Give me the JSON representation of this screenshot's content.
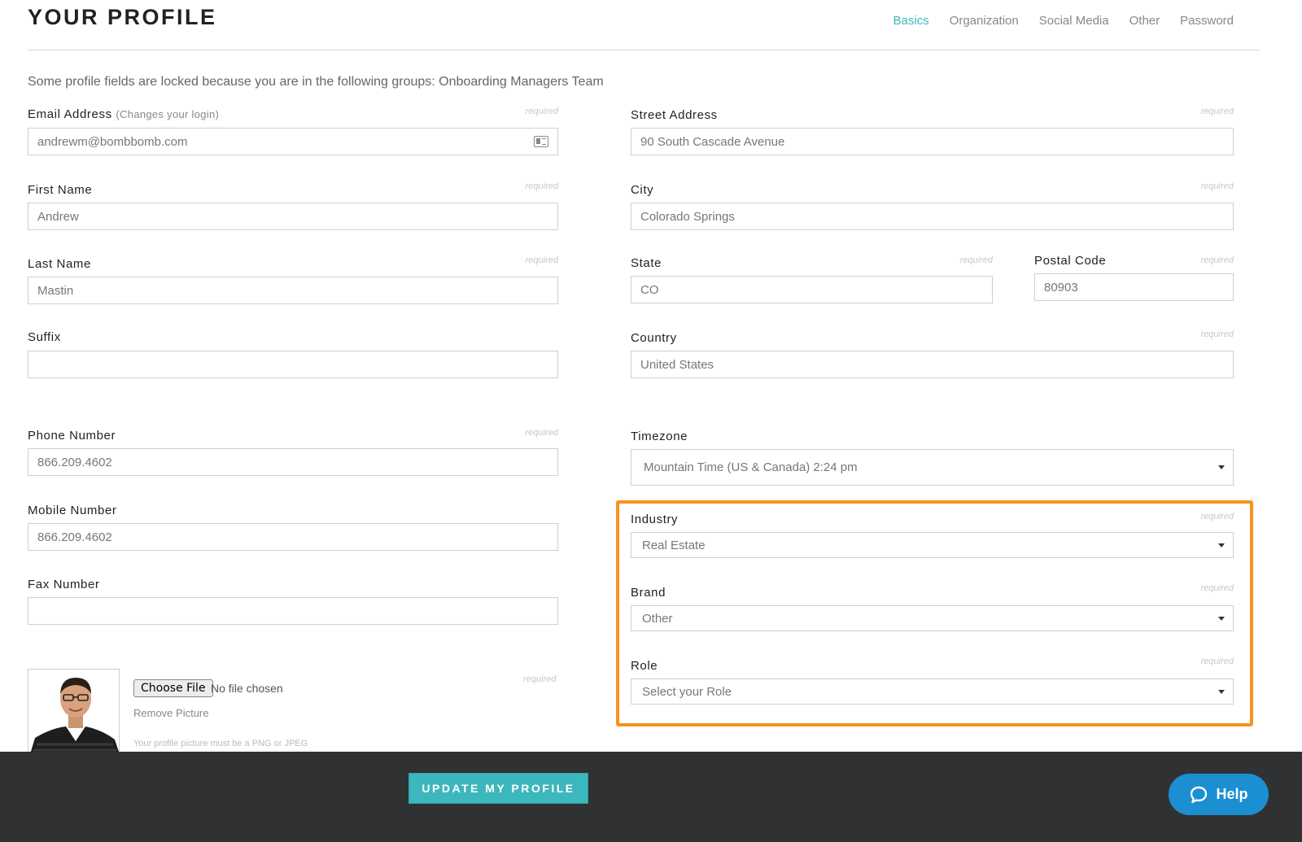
{
  "header": {
    "title": "YOUR PROFILE",
    "tabs": [
      {
        "label": "Basics",
        "active": true
      },
      {
        "label": "Organization",
        "active": false
      },
      {
        "label": "Social Media",
        "active": false
      },
      {
        "label": "Other",
        "active": false
      },
      {
        "label": "Password",
        "active": false
      }
    ]
  },
  "notice": "Some profile fields are locked because you are in the following groups: Onboarding Managers Team",
  "required_text": "required",
  "fields": {
    "email": {
      "label": "Email Address",
      "hint": "(Changes your login)",
      "value": "andrewm@bombbomb.com"
    },
    "first_name": {
      "label": "First Name",
      "value": "Andrew"
    },
    "last_name": {
      "label": "Last Name",
      "value": "Mastin"
    },
    "suffix": {
      "label": "Suffix",
      "value": ""
    },
    "phone": {
      "label": "Phone Number",
      "value": "866.209.4602"
    },
    "mobile": {
      "label": "Mobile Number",
      "value": "866.209.4602"
    },
    "fax": {
      "label": "Fax Number",
      "value": ""
    },
    "street": {
      "label": "Street Address",
      "value": "90 South Cascade Avenue"
    },
    "city": {
      "label": "City",
      "value": "Colorado Springs"
    },
    "state": {
      "label": "State",
      "value": "CO"
    },
    "postal": {
      "label": "Postal Code",
      "value": "80903"
    },
    "country": {
      "label": "Country",
      "value": "United States"
    },
    "timezone": {
      "label": "Timezone",
      "value": "Mountain Time (US & Canada) 2:24 pm"
    },
    "industry": {
      "label": "Industry",
      "value": "Real Estate"
    },
    "brand": {
      "label": "Brand",
      "value": "Other"
    },
    "role": {
      "label": "Role",
      "value": "Select your Role"
    }
  },
  "picture": {
    "choose_file": "Choose File",
    "no_file": "No file chosen",
    "remove": "Remove Picture",
    "hint": "Your profile picture must be a PNG or JPEG"
  },
  "footer": {
    "update_label": "UPDATE MY PROFILE",
    "help_label": "Help"
  },
  "colors": {
    "accent": "#3bb7bd",
    "highlight": "#f7931e",
    "footer_bg": "#303132",
    "help_blue": "#1b8fd1"
  }
}
